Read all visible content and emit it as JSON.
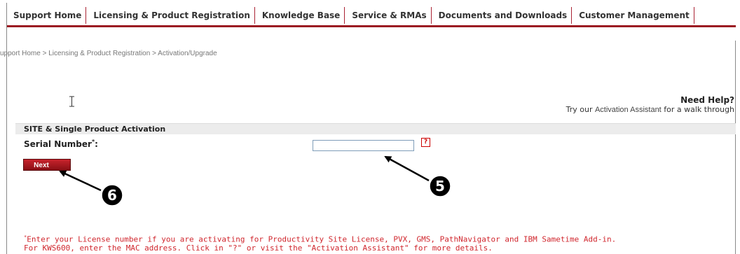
{
  "nav": {
    "items": [
      {
        "label": "Support Home"
      },
      {
        "label": "Licensing & Product Registration"
      },
      {
        "label": "Knowledge Base"
      },
      {
        "label": "Service & RMAs"
      },
      {
        "label": "Documents and Downloads"
      },
      {
        "label": "Customer Management"
      }
    ]
  },
  "breadcrumb": {
    "items": [
      "upport Home",
      "Licensing & Product Registration",
      "Activation/Upgrade"
    ],
    "separator": ">"
  },
  "help": {
    "title": "Need Help?",
    "prefix": "Try our ",
    "link": "Activation Assistant",
    "suffix": " for a walk through"
  },
  "section": {
    "title": "SITE & Single Product Activation"
  },
  "form": {
    "serial_label": "Serial Number",
    "required_mark": "*",
    "colon": ":",
    "serial_value": "",
    "help_icon_label": "?",
    "next_label": "Next"
  },
  "callouts": {
    "input_number": "5",
    "next_number": "6"
  },
  "footnote": {
    "mark": "*",
    "line1": "Enter your License number if you are activating for Productivity Site License, PVX, GMS, PathNavigator and IBM Sametime Add-in.",
    "line2": "For KWS600, enter the MAC address. Click in \"?\" or visit the \"Activation Assistant\" for more details."
  },
  "colors": {
    "brand_red": "#9b1a22",
    "footnote_red": "#d0262d",
    "input_border": "#7f9db9"
  }
}
